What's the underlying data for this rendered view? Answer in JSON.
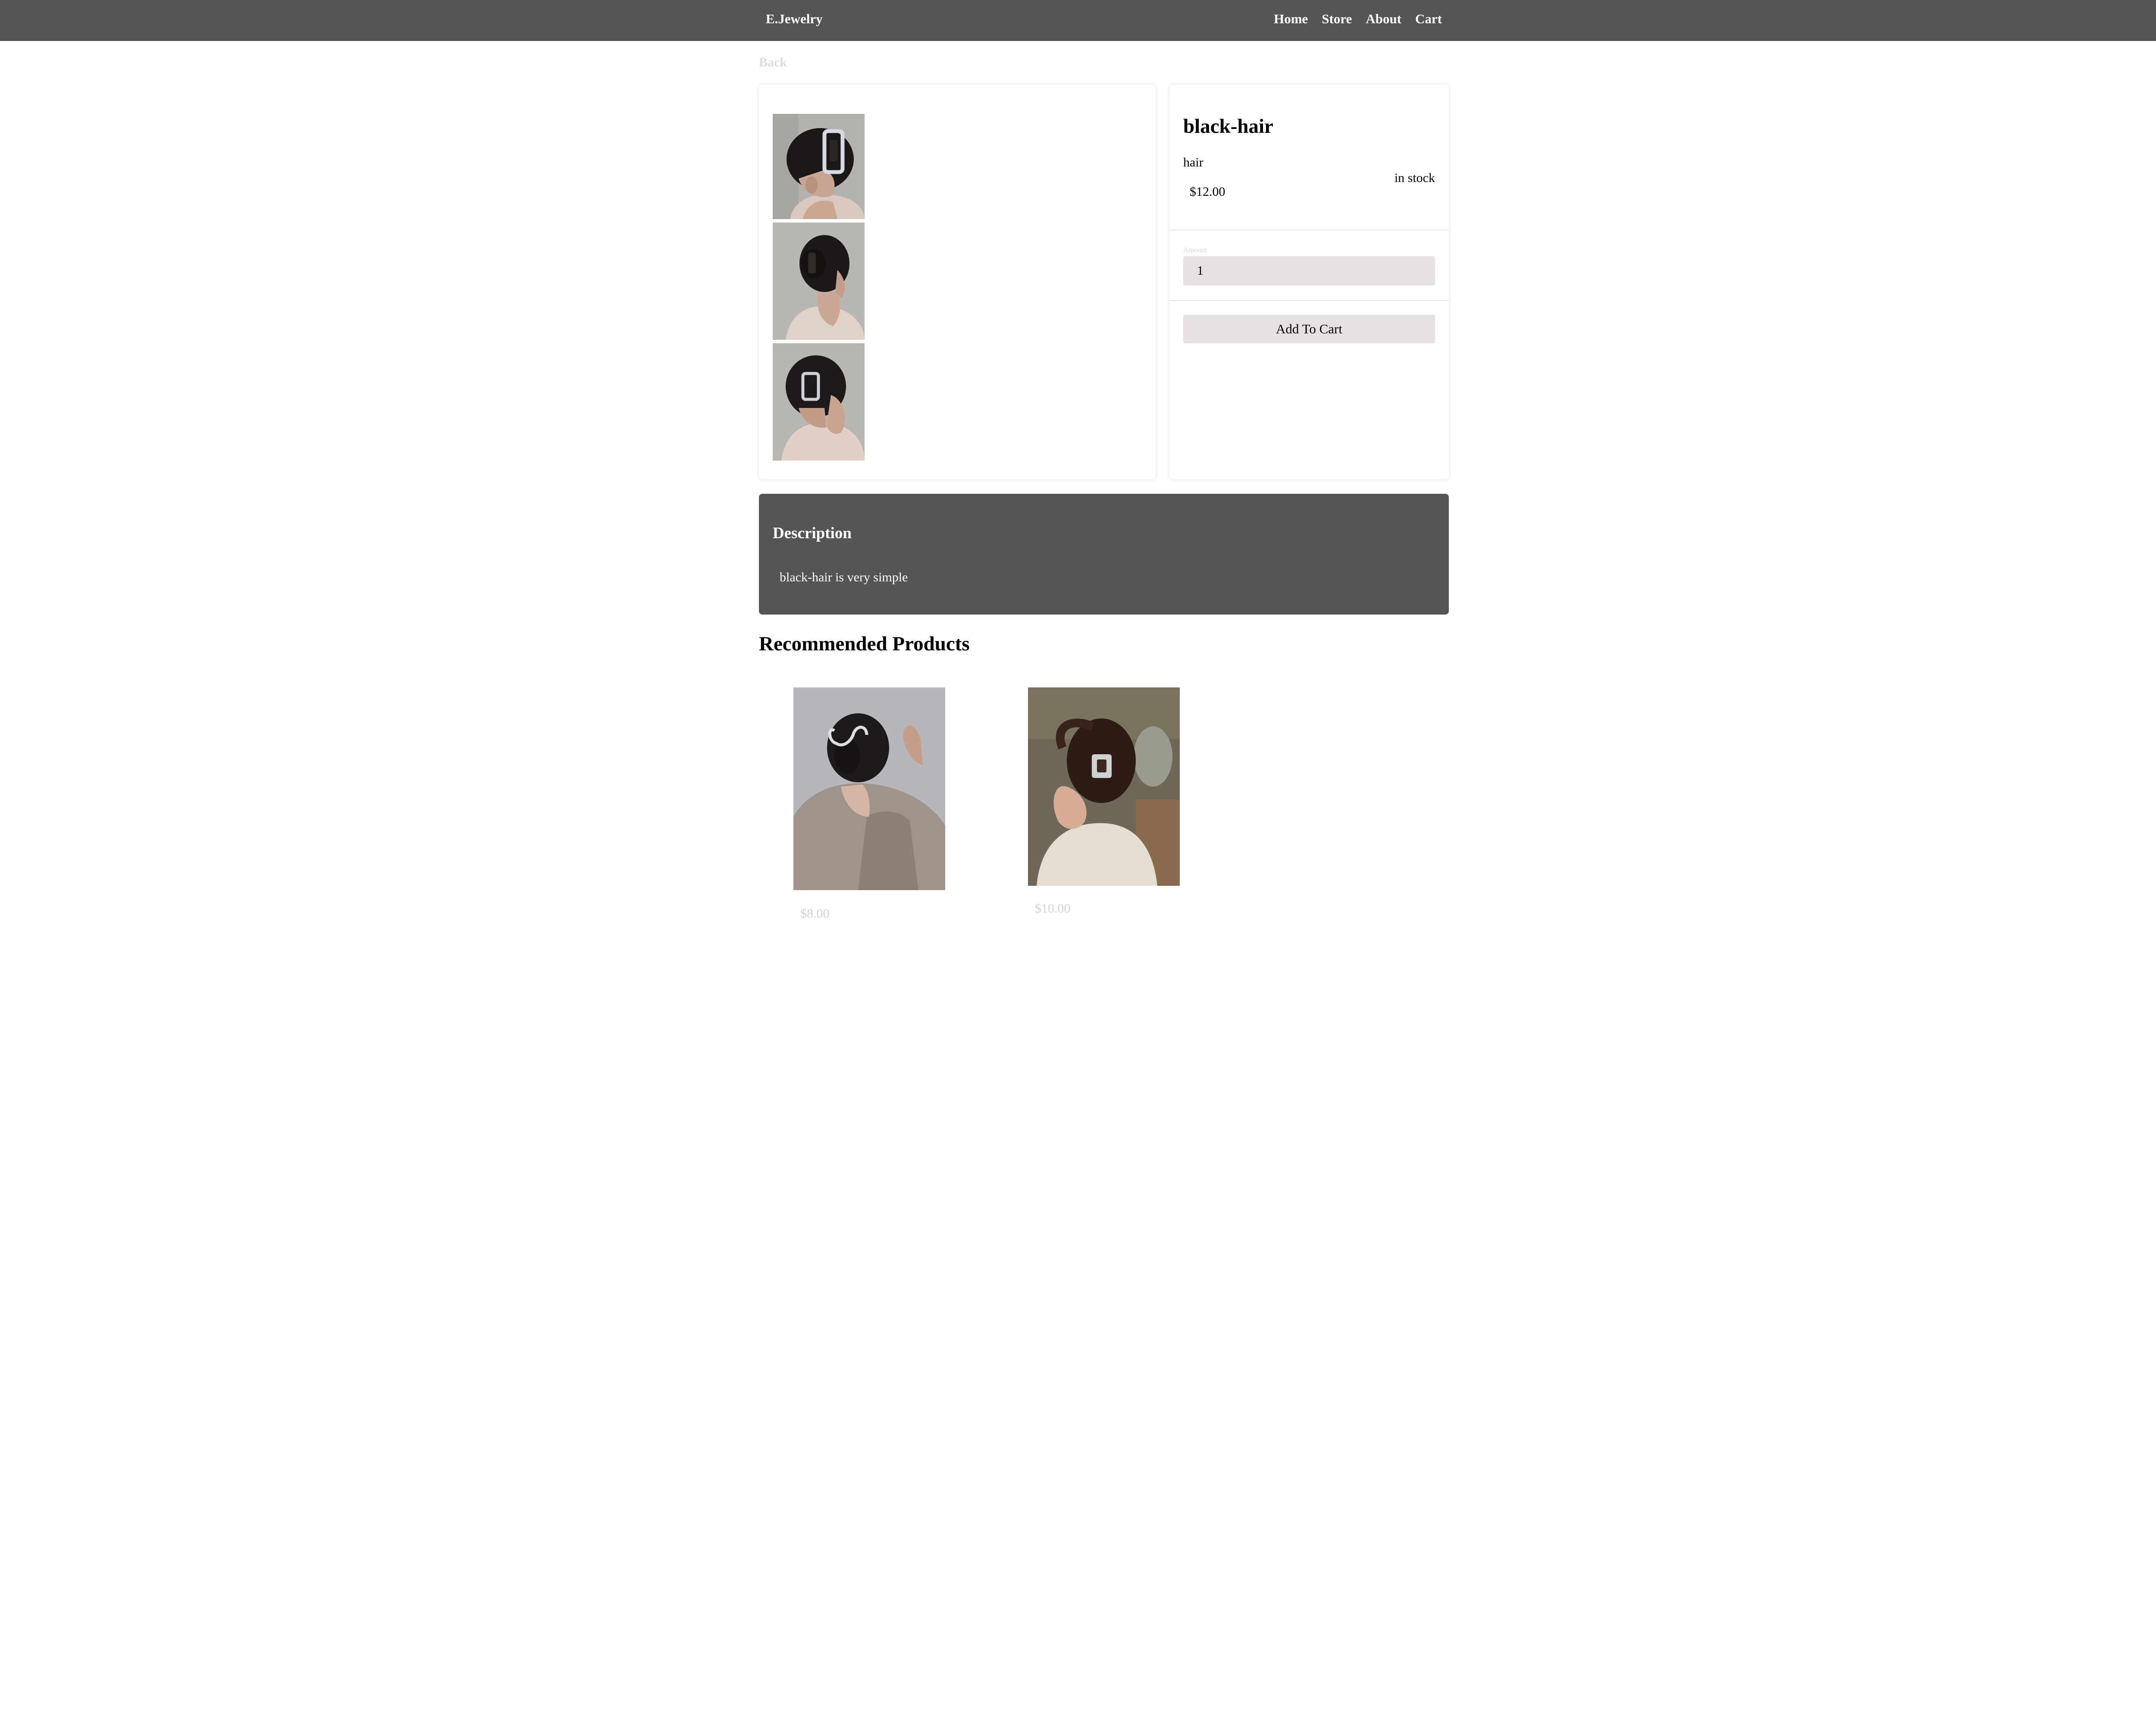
{
  "navbar": {
    "brand": "E.Jewelry",
    "links": [
      "Home",
      "Store",
      "About",
      "Cart"
    ]
  },
  "back_label": "Back",
  "product": {
    "title": "black-hair",
    "category": "hair",
    "price": "$12.00",
    "stock": "in stock",
    "amount_label": "Amount",
    "amount_value": "1",
    "add_to_cart_label": "Add To Cart"
  },
  "description": {
    "title": "Description",
    "text": "black-hair is very simple"
  },
  "recommended": {
    "heading": "Recommended Products",
    "items": [
      {
        "price": "$8.00"
      },
      {
        "price": "$10.00"
      }
    ]
  },
  "colors": {
    "navbar_bg": "#555555",
    "button_bg": "#e6e0e2",
    "muted_text": "#d3d3d3"
  }
}
